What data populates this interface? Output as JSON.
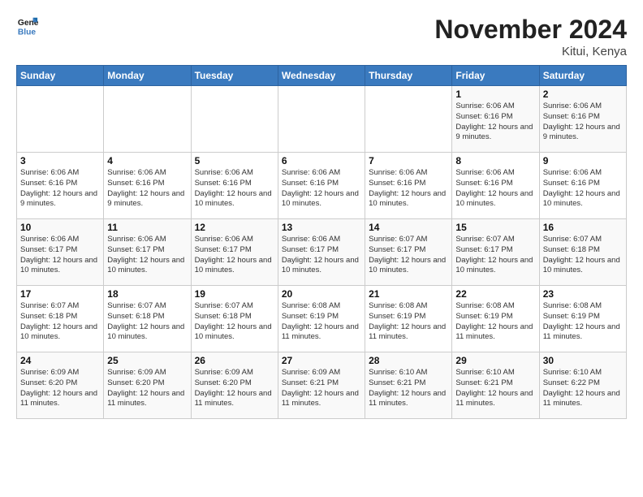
{
  "header": {
    "logo_line1": "General",
    "logo_line2": "Blue",
    "month": "November 2024",
    "location": "Kitui, Kenya"
  },
  "days_of_week": [
    "Sunday",
    "Monday",
    "Tuesday",
    "Wednesday",
    "Thursday",
    "Friday",
    "Saturday"
  ],
  "weeks": [
    [
      {
        "day": "",
        "text": ""
      },
      {
        "day": "",
        "text": ""
      },
      {
        "day": "",
        "text": ""
      },
      {
        "day": "",
        "text": ""
      },
      {
        "day": "",
        "text": ""
      },
      {
        "day": "1",
        "text": "Sunrise: 6:06 AM\nSunset: 6:16 PM\nDaylight: 12 hours and 9 minutes."
      },
      {
        "day": "2",
        "text": "Sunrise: 6:06 AM\nSunset: 6:16 PM\nDaylight: 12 hours and 9 minutes."
      }
    ],
    [
      {
        "day": "3",
        "text": "Sunrise: 6:06 AM\nSunset: 6:16 PM\nDaylight: 12 hours and 9 minutes."
      },
      {
        "day": "4",
        "text": "Sunrise: 6:06 AM\nSunset: 6:16 PM\nDaylight: 12 hours and 9 minutes."
      },
      {
        "day": "5",
        "text": "Sunrise: 6:06 AM\nSunset: 6:16 PM\nDaylight: 12 hours and 10 minutes."
      },
      {
        "day": "6",
        "text": "Sunrise: 6:06 AM\nSunset: 6:16 PM\nDaylight: 12 hours and 10 minutes."
      },
      {
        "day": "7",
        "text": "Sunrise: 6:06 AM\nSunset: 6:16 PM\nDaylight: 12 hours and 10 minutes."
      },
      {
        "day": "8",
        "text": "Sunrise: 6:06 AM\nSunset: 6:16 PM\nDaylight: 12 hours and 10 minutes."
      },
      {
        "day": "9",
        "text": "Sunrise: 6:06 AM\nSunset: 6:16 PM\nDaylight: 12 hours and 10 minutes."
      }
    ],
    [
      {
        "day": "10",
        "text": "Sunrise: 6:06 AM\nSunset: 6:17 PM\nDaylight: 12 hours and 10 minutes."
      },
      {
        "day": "11",
        "text": "Sunrise: 6:06 AM\nSunset: 6:17 PM\nDaylight: 12 hours and 10 minutes."
      },
      {
        "day": "12",
        "text": "Sunrise: 6:06 AM\nSunset: 6:17 PM\nDaylight: 12 hours and 10 minutes."
      },
      {
        "day": "13",
        "text": "Sunrise: 6:06 AM\nSunset: 6:17 PM\nDaylight: 12 hours and 10 minutes."
      },
      {
        "day": "14",
        "text": "Sunrise: 6:07 AM\nSunset: 6:17 PM\nDaylight: 12 hours and 10 minutes."
      },
      {
        "day": "15",
        "text": "Sunrise: 6:07 AM\nSunset: 6:17 PM\nDaylight: 12 hours and 10 minutes."
      },
      {
        "day": "16",
        "text": "Sunrise: 6:07 AM\nSunset: 6:18 PM\nDaylight: 12 hours and 10 minutes."
      }
    ],
    [
      {
        "day": "17",
        "text": "Sunrise: 6:07 AM\nSunset: 6:18 PM\nDaylight: 12 hours and 10 minutes."
      },
      {
        "day": "18",
        "text": "Sunrise: 6:07 AM\nSunset: 6:18 PM\nDaylight: 12 hours and 10 minutes."
      },
      {
        "day": "19",
        "text": "Sunrise: 6:07 AM\nSunset: 6:18 PM\nDaylight: 12 hours and 10 minutes."
      },
      {
        "day": "20",
        "text": "Sunrise: 6:08 AM\nSunset: 6:19 PM\nDaylight: 12 hours and 11 minutes."
      },
      {
        "day": "21",
        "text": "Sunrise: 6:08 AM\nSunset: 6:19 PM\nDaylight: 12 hours and 11 minutes."
      },
      {
        "day": "22",
        "text": "Sunrise: 6:08 AM\nSunset: 6:19 PM\nDaylight: 12 hours and 11 minutes."
      },
      {
        "day": "23",
        "text": "Sunrise: 6:08 AM\nSunset: 6:19 PM\nDaylight: 12 hours and 11 minutes."
      }
    ],
    [
      {
        "day": "24",
        "text": "Sunrise: 6:09 AM\nSunset: 6:20 PM\nDaylight: 12 hours and 11 minutes."
      },
      {
        "day": "25",
        "text": "Sunrise: 6:09 AM\nSunset: 6:20 PM\nDaylight: 12 hours and 11 minutes."
      },
      {
        "day": "26",
        "text": "Sunrise: 6:09 AM\nSunset: 6:20 PM\nDaylight: 12 hours and 11 minutes."
      },
      {
        "day": "27",
        "text": "Sunrise: 6:09 AM\nSunset: 6:21 PM\nDaylight: 12 hours and 11 minutes."
      },
      {
        "day": "28",
        "text": "Sunrise: 6:10 AM\nSunset: 6:21 PM\nDaylight: 12 hours and 11 minutes."
      },
      {
        "day": "29",
        "text": "Sunrise: 6:10 AM\nSunset: 6:21 PM\nDaylight: 12 hours and 11 minutes."
      },
      {
        "day": "30",
        "text": "Sunrise: 6:10 AM\nSunset: 6:22 PM\nDaylight: 12 hours and 11 minutes."
      }
    ]
  ]
}
